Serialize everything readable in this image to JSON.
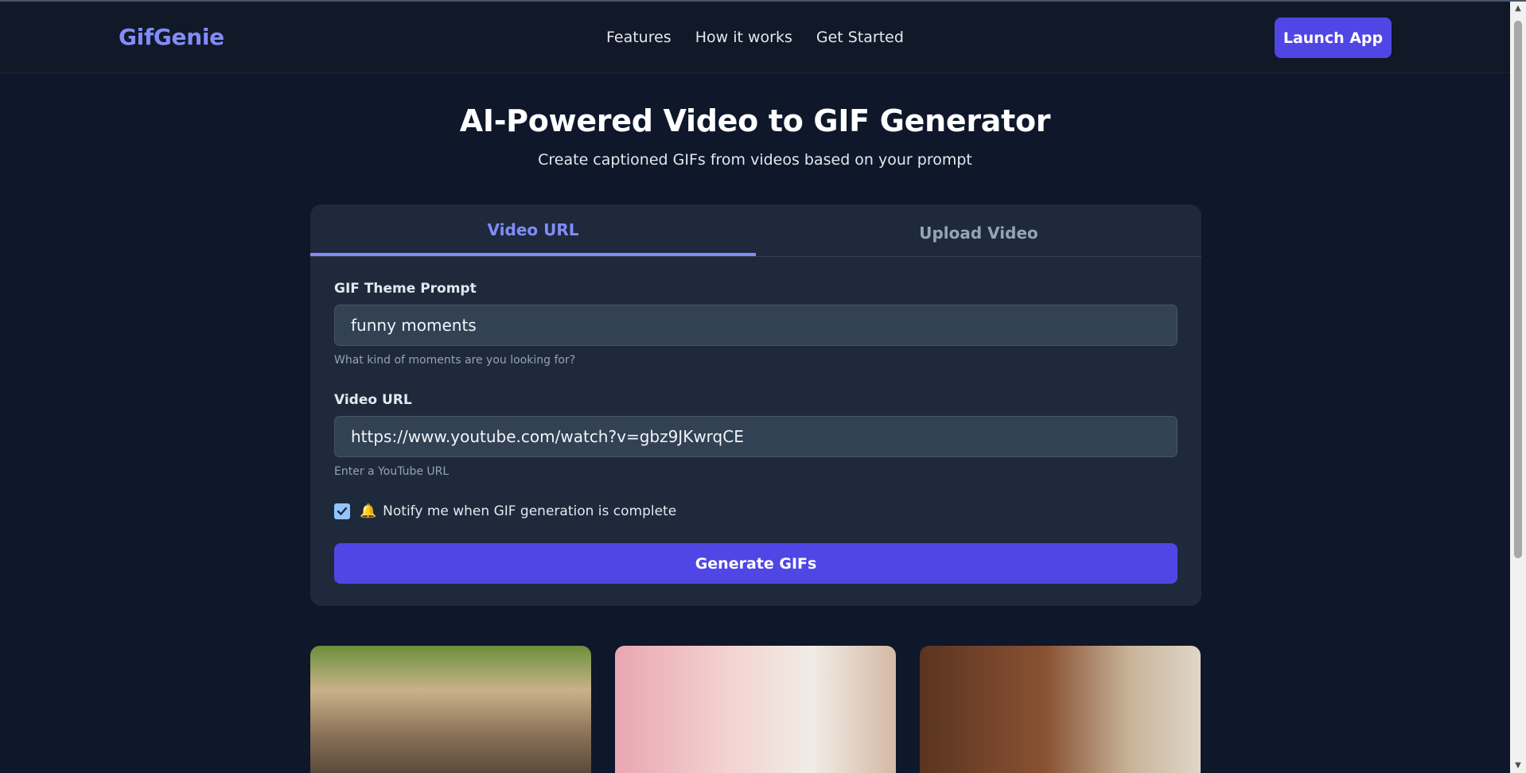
{
  "header": {
    "logo": "GifGenie",
    "links": [
      "Features",
      "How it works",
      "Get Started"
    ],
    "cta": "Launch App"
  },
  "hero": {
    "title": "AI-Powered Video to GIF Generator",
    "subtitle": "Create captioned GIFs from videos based on your prompt"
  },
  "card": {
    "tabs": [
      "Video URL",
      "Upload Video"
    ],
    "active_tab": "Video URL",
    "prompt": {
      "label": "GIF Theme Prompt",
      "value": "funny moments",
      "hint": "What kind of moments are you looking for?"
    },
    "url": {
      "label": "Video URL",
      "value": "https://www.youtube.com/watch?v=gbz9JKwrqCE",
      "hint": "Enter a YouTube URL"
    },
    "notify": {
      "checked": true,
      "icon": "bell-icon",
      "label": "Notify me when GIF generation is complete"
    },
    "submit": "Generate GIFs"
  },
  "gallery": {
    "items": [
      {
        "name": "gif-preview-1"
      },
      {
        "name": "gif-preview-2"
      },
      {
        "name": "gif-preview-3"
      }
    ]
  },
  "colors": {
    "background": "#0f172a",
    "card": "#1e293b",
    "accent": "#818cf8",
    "button": "#4f46e5"
  }
}
